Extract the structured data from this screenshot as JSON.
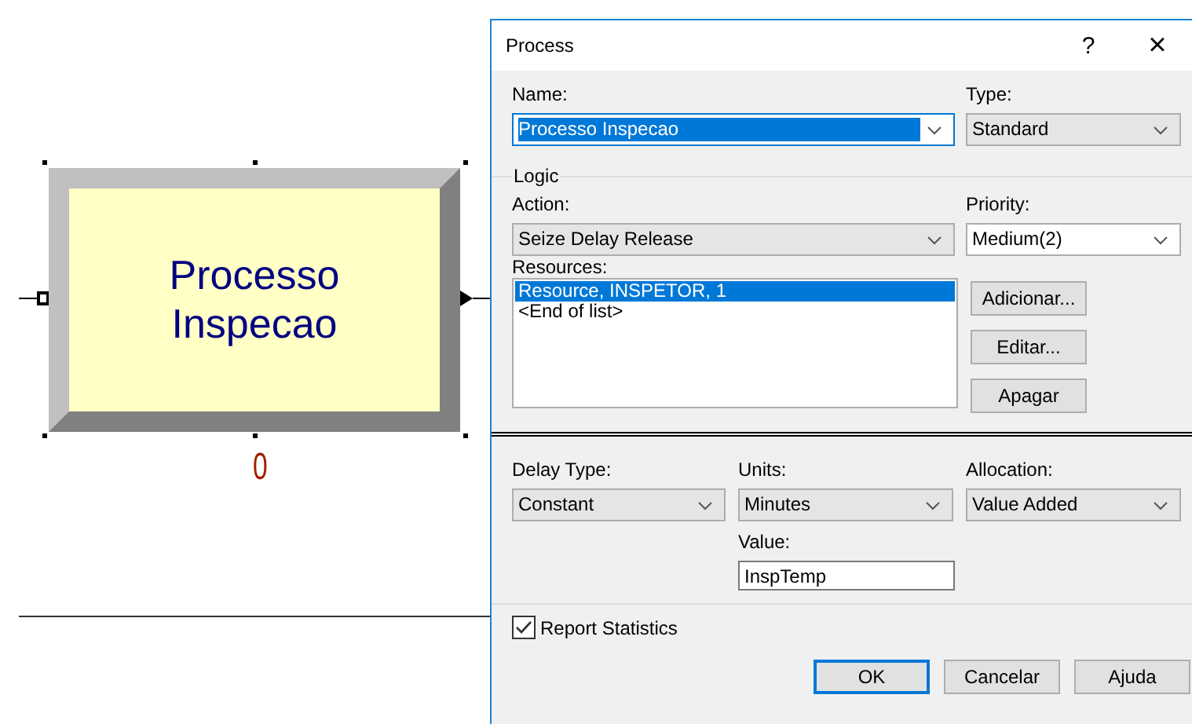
{
  "canvas": {
    "module": {
      "lines": [
        "Processo",
        "Inspecao"
      ],
      "selected": true,
      "counter": "0"
    }
  },
  "dialog": {
    "title": "Process",
    "help": "?",
    "close": "×",
    "name": {
      "label": "Name:",
      "value": "Processo Inspecao",
      "selected": true
    },
    "type": {
      "label": "Type:",
      "value": "Standard"
    },
    "logic": {
      "label": "Logic",
      "action": {
        "label": "Action:",
        "value": "Seize Delay Release"
      },
      "priority": {
        "label": "Priority:",
        "value": "Medium(2)"
      },
      "resources": {
        "label": "Resources:",
        "items": [
          {
            "text": "Resource, INSPETOR, 1",
            "selected": true
          },
          {
            "text": "<End of list>",
            "selected": false
          }
        ],
        "buttons": [
          "Adicionar...",
          "Editar...",
          "Apagar"
        ]
      },
      "delay_type": {
        "label": "Delay Type:",
        "value": "Constant"
      },
      "units": {
        "label": "Units:",
        "value": "Minutes"
      },
      "allocation": {
        "label": "Allocation:",
        "value": "Value Added"
      },
      "value": {
        "label": "Value:",
        "value": "InspTemp"
      }
    },
    "report_statistics": {
      "label": "Report Statistics",
      "checked": true
    },
    "buttons": [
      {
        "label": "OK",
        "default": true
      },
      {
        "label": "Cancelar",
        "default": false
      },
      {
        "label": "Ajuda",
        "default": false
      }
    ]
  }
}
